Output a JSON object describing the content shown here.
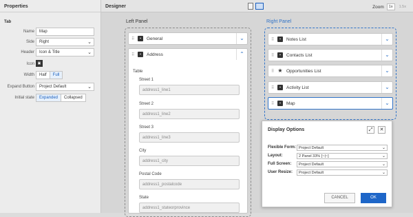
{
  "properties": {
    "title": "Properties",
    "section": "Tab",
    "name_label": "Name",
    "name_value": "Map",
    "side_label": "Side",
    "side_value": "Right",
    "header_label": "Header",
    "header_value": "Icon & Title",
    "icon_label": "Icon",
    "width_label": "Width",
    "width_options": [
      "Half",
      "Full"
    ],
    "width_selected": "Full",
    "expand_label": "Expand Button",
    "expand_value": "Project Default",
    "initial_label": "Initial state",
    "initial_options": [
      "Expanded",
      "Collapsed"
    ],
    "initial_selected": "Expanded"
  },
  "designer": {
    "title": "Designer",
    "zoom_label": "Zoom",
    "zoom_options": [
      "1x",
      "1.5x"
    ]
  },
  "left_panel": {
    "title": "Left Panel",
    "tabs": [
      "General",
      "Address"
    ],
    "table_label": "Table",
    "fields": [
      {
        "label": "Street 1",
        "value": "address1_line1"
      },
      {
        "label": "Street 2",
        "value": "address1_line2"
      },
      {
        "label": "Street 3",
        "value": "address1_line3"
      },
      {
        "label": "City",
        "value": "address1_city"
      },
      {
        "label": "Postal Code",
        "value": "address1_postalcode"
      },
      {
        "label": "State",
        "value": "address1_stateorprovince"
      }
    ]
  },
  "right_panel": {
    "title": "Right Panel",
    "tabs": [
      "Notes List",
      "Contacts List",
      "Opportunities List",
      "Activity List",
      "Map"
    ]
  },
  "dialog": {
    "title": "Display Options",
    "rows": [
      {
        "label": "Flexible Form:",
        "value": "Project Default"
      },
      {
        "label": "Layout:",
        "value": "2 Panel 33% [~|~]"
      },
      {
        "label": "Full Screen:",
        "value": "Project Default"
      },
      {
        "label": "User Resize:",
        "value": "Project Default"
      }
    ],
    "cancel": "CANCEL",
    "ok": "OK"
  },
  "colors": {
    "accent": "#1e66c8",
    "panel_border": "#2f72c7"
  }
}
